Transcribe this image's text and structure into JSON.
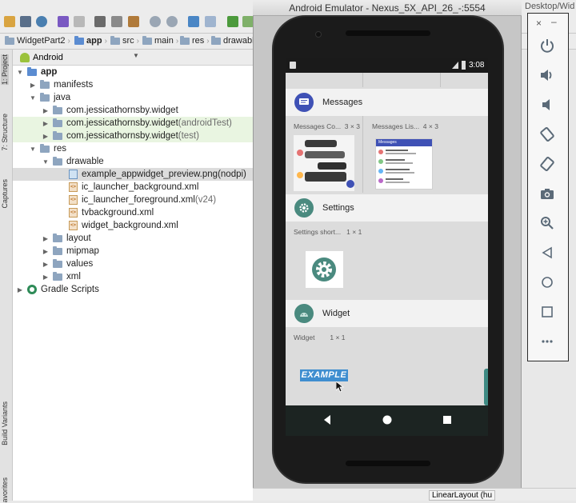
{
  "ide": {
    "breadcrumbs": [
      "WidgetPart2",
      "app",
      "src",
      "main",
      "res",
      "drawabl"
    ],
    "top_right_path": "Desktop/Wid",
    "project_view": "Android",
    "side_tabs": [
      "1: Project",
      "7: Structure",
      "Captures",
      "Build Variants",
      "avorites"
    ],
    "status_strip": "LinearLayout (hu"
  },
  "tree": [
    {
      "label": "app",
      "suffix": ""
    },
    {
      "label": "manifests",
      "suffix": ""
    },
    {
      "label": "java",
      "suffix": ""
    },
    {
      "label": "com.jessicathornsby.widget",
      "suffix": ""
    },
    {
      "label": "com.jessicathornsby.widget",
      "suffix": " (androidTest)"
    },
    {
      "label": "com.jessicathornsby.widget",
      "suffix": " (test)"
    },
    {
      "label": "res",
      "suffix": ""
    },
    {
      "label": "drawable",
      "suffix": ""
    },
    {
      "label": "example_appwidget_preview.png",
      "suffix": " (nodpi)"
    },
    {
      "label": "ic_launcher_background.xml",
      "suffix": ""
    },
    {
      "label": "ic_launcher_foreground.xml",
      "suffix": " (v24)"
    },
    {
      "label": "tvbackground.xml",
      "suffix": ""
    },
    {
      "label": "widget_background.xml",
      "suffix": ""
    },
    {
      "label": "layout",
      "suffix": ""
    },
    {
      "label": "mipmap",
      "suffix": ""
    },
    {
      "label": "values",
      "suffix": ""
    },
    {
      "label": "xml",
      "suffix": ""
    },
    {
      "label": "Gradle Scripts",
      "suffix": ""
    }
  ],
  "emulator": {
    "title": "Android Emulator - Nexus_5X_API_26_-:5554",
    "time": "3:08",
    "sections": [
      {
        "name": "Messages",
        "widgets": [
          {
            "label": "Messages Co...",
            "size": "3 × 3"
          },
          {
            "label": "Messages Lis...",
            "size": "4 × 3"
          }
        ]
      },
      {
        "name": "Settings",
        "widgets": [
          {
            "label": "Settings short...",
            "size": "1 × 1"
          }
        ]
      },
      {
        "name": "Widget",
        "widgets": [
          {
            "label": "Widget",
            "size": "1 × 1"
          }
        ]
      }
    ],
    "widget_preview_text": "EXAMPLE",
    "messages_preview_header": "Messages"
  },
  "colors": {
    "messages_accent": "#3f51b5",
    "settings_accent": "#4a8a7f",
    "widget_accent": "#4a8a7f",
    "example_bg": "#3f8ed0"
  },
  "controls": [
    "close-icon",
    "minimize-icon",
    "power-icon",
    "volume-up-icon",
    "volume-down-icon",
    "rotate-left-icon",
    "rotate-right-icon",
    "camera-icon",
    "zoom-icon",
    "back-icon",
    "home-icon",
    "overview-icon",
    "more-icon"
  ]
}
